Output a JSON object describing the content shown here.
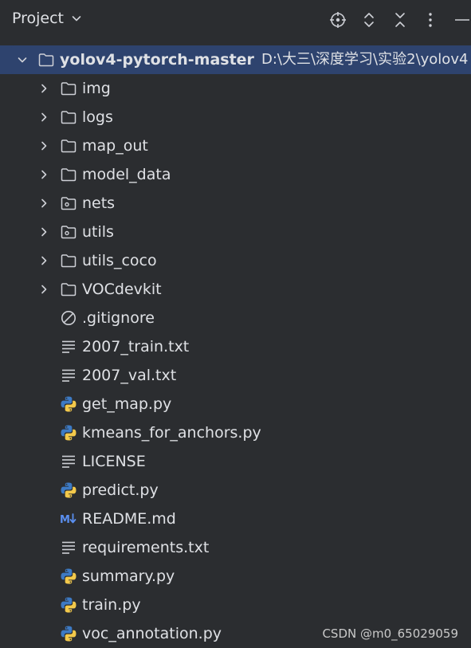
{
  "header": {
    "title": "Project"
  },
  "tree": {
    "root": {
      "name": "yolov4-pytorch-master",
      "path": "D:\\大三\\深度学习\\实验2\\yolov4"
    },
    "items": [
      {
        "label": "img",
        "kind": "folder",
        "expandable": true
      },
      {
        "label": "logs",
        "kind": "folder",
        "expandable": true
      },
      {
        "label": "map_out",
        "kind": "folder",
        "expandable": true
      },
      {
        "label": "model_data",
        "kind": "folder",
        "expandable": true
      },
      {
        "label": "nets",
        "kind": "package",
        "expandable": true
      },
      {
        "label": "utils",
        "kind": "package",
        "expandable": true
      },
      {
        "label": "utils_coco",
        "kind": "folder",
        "expandable": true
      },
      {
        "label": "VOCdevkit",
        "kind": "folder",
        "expandable": true
      },
      {
        "label": ".gitignore",
        "kind": "ignore",
        "expandable": false
      },
      {
        "label": "2007_train.txt",
        "kind": "text",
        "expandable": false
      },
      {
        "label": "2007_val.txt",
        "kind": "text",
        "expandable": false
      },
      {
        "label": "get_map.py",
        "kind": "python",
        "expandable": false
      },
      {
        "label": "kmeans_for_anchors.py",
        "kind": "python",
        "expandable": false
      },
      {
        "label": "LICENSE",
        "kind": "text",
        "expandable": false
      },
      {
        "label": "predict.py",
        "kind": "python",
        "expandable": false
      },
      {
        "label": "README.md",
        "kind": "markdown",
        "expandable": false
      },
      {
        "label": "requirements.txt",
        "kind": "text",
        "expandable": false
      },
      {
        "label": "summary.py",
        "kind": "python",
        "expandable": false
      },
      {
        "label": "train.py",
        "kind": "python",
        "expandable": false
      },
      {
        "label": "voc_annotation.py",
        "kind": "python",
        "expandable": false
      }
    ]
  },
  "watermark": "CSDN @m0_65029059",
  "colors": {
    "background": "#2b2d30",
    "selection": "#2e436e",
    "text": "#dfe1e5",
    "icon": "#ced0d6",
    "python_blue": "#3d7ac4",
    "python_yellow": "#f3c94b",
    "markdown_blue": "#5a8ff0"
  }
}
